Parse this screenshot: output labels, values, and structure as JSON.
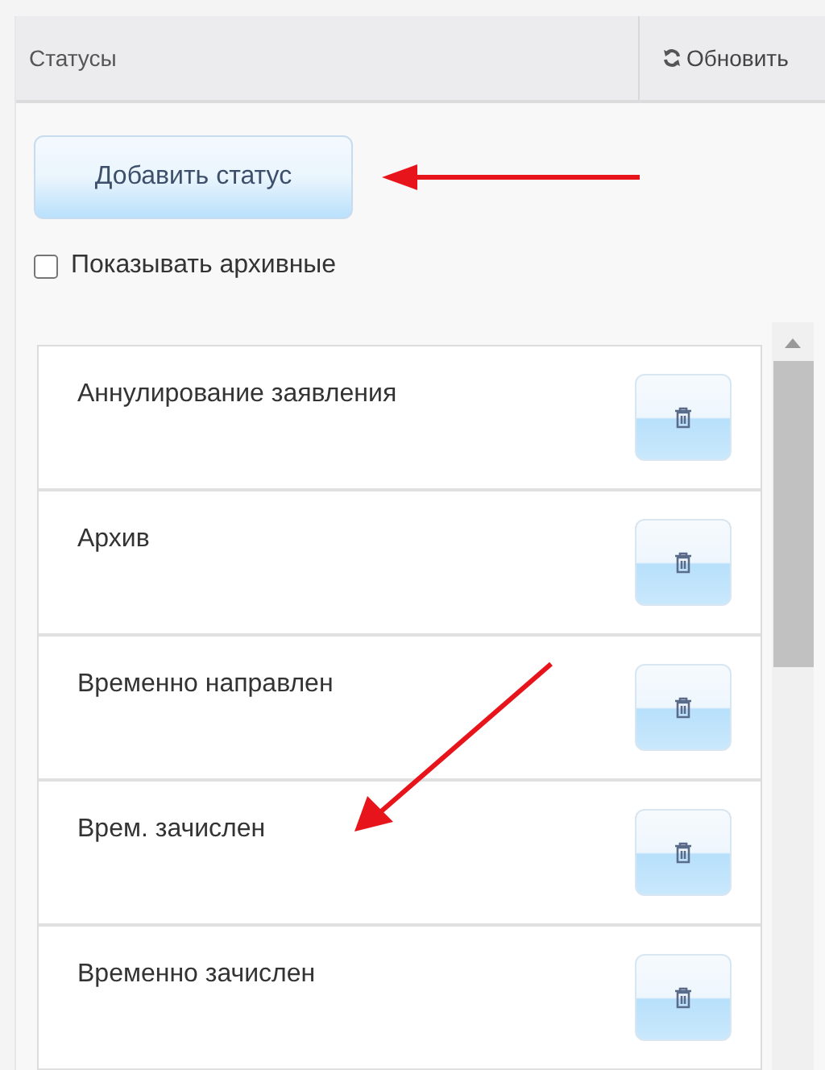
{
  "panel": {
    "title": "Статусы",
    "refresh_label": "Обновить"
  },
  "add_button": "Добавить статус",
  "show_archived": {
    "label": "Показывать архивные",
    "checked": false
  },
  "statuses": [
    {
      "name": "Аннулирование заявления"
    },
    {
      "name": "Архив"
    },
    {
      "name": "Временно направлен"
    },
    {
      "name": "Врем. зачислен"
    },
    {
      "name": "Временно зачислен"
    }
  ]
}
